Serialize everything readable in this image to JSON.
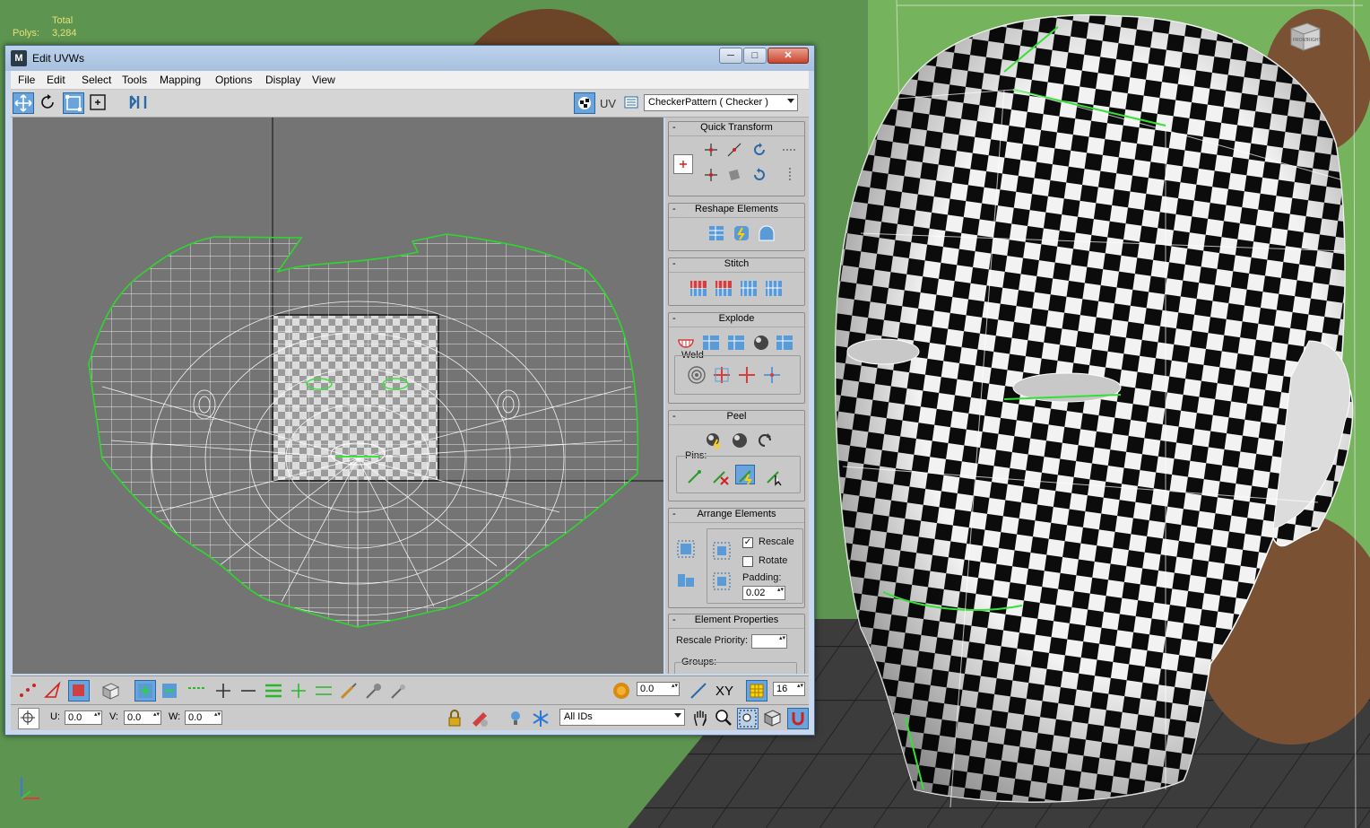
{
  "viewport": {
    "stats_total_label": "Total",
    "stats_polys_label": "Polys:",
    "stats_polys_value": "3,284",
    "viewcube_front": "FRONT",
    "viewcube_right": "RIGHT"
  },
  "window": {
    "app_icon": "M",
    "title": "Edit UVWs",
    "minimize": "─",
    "maximize": "□",
    "close": "✕"
  },
  "menubar": [
    "File",
    "Edit",
    "Select",
    "Tools",
    "Mapping",
    "Options",
    "Display",
    "View"
  ],
  "toolbar": {
    "uv_label": "UV",
    "texture_dropdown": "CheckerPattern ( Checker )"
  },
  "panel": {
    "quick_transform": "Quick Transform",
    "reshape_elements": "Reshape Elements",
    "stitch": "Stitch",
    "explode": "Explode",
    "weld": "Weld",
    "peel": "Peel",
    "pins": "Pins:",
    "arrange_elements": "Arrange Elements",
    "rescale": "Rescale",
    "rescale_checked": "✓",
    "rotate": "Rotate",
    "padding_label": "Padding:",
    "padding_value": "0.02",
    "element_properties": "Element Properties",
    "rescale_priority": "Rescale Priority:",
    "groups": "Groups:"
  },
  "bottombar": {
    "soft_select_value": "0.0",
    "xy_label": "XY",
    "grid_value": "16",
    "u_label": "U:",
    "u_value": "0.0",
    "v_label": "V:",
    "v_value": "0.0",
    "w_label": "W:",
    "w_value": "0.0",
    "ids_dropdown": "All IDs"
  },
  "colors": {
    "uv_background": "#747474",
    "wire": "#ffffff",
    "seam": "#28d228",
    "panel": "#c6c6c6",
    "titlebar": "#bcd2ec",
    "active_tool": "#6aa4dc",
    "viewport_green": "#5c8f4c"
  }
}
